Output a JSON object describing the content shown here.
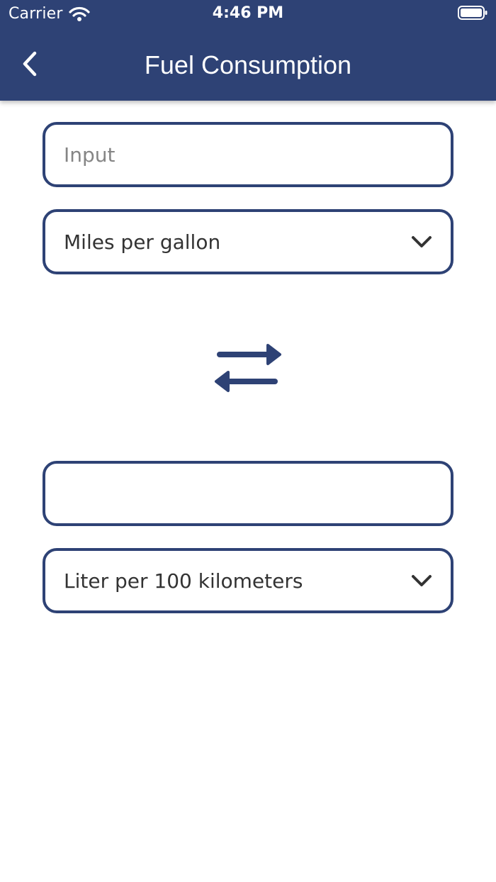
{
  "status_bar": {
    "carrier": "Carrier",
    "time": "4:46 PM",
    "wifi_icon": "wifi-icon",
    "battery_icon": "battery-icon"
  },
  "nav": {
    "back_icon": "chevron-left-icon",
    "title": "Fuel Consumption"
  },
  "converter": {
    "input_field": {
      "value": "",
      "placeholder": "Input"
    },
    "from_unit": {
      "selected": "Miles per gallon",
      "icon": "chevron-down-icon"
    },
    "swap_icon": "swap-arrows-icon",
    "output_field": {
      "value": "",
      "placeholder": ""
    },
    "to_unit": {
      "selected": "Liter per 100 kilometers",
      "icon": "chevron-down-icon"
    }
  },
  "colors": {
    "primary": "#2e4275",
    "background": "#ffffff",
    "text": "#333333",
    "placeholder": "#858585"
  }
}
